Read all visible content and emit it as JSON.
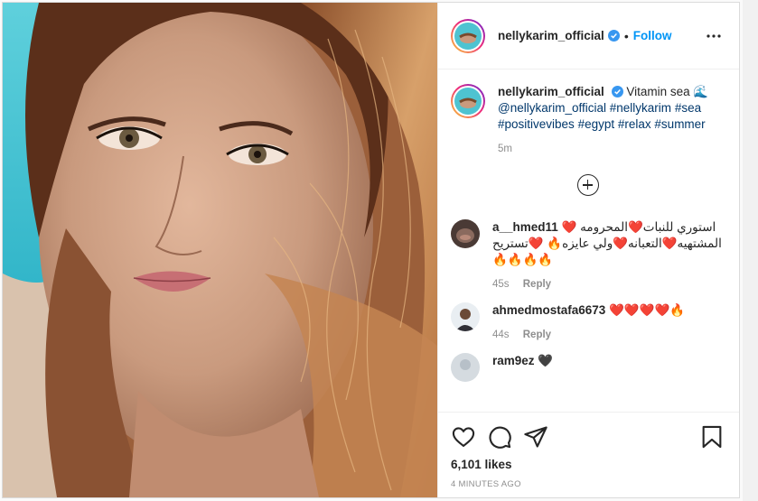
{
  "post": {
    "username": "nellykarim_official",
    "follow_label": "Follow",
    "dot": "•"
  },
  "caption": {
    "username": "nellykarim_official",
    "text": "Vitamin sea 🌊",
    "mention": "@nellykarim_official",
    "hashtags": [
      "#nellykarim",
      "#sea",
      "#positivevibes",
      "#egypt",
      "#relax",
      "#summer"
    ],
    "age": "5m"
  },
  "comments": [
    {
      "username": "a__hmed11",
      "text": "استوري للنبات❤️المحرومه ❤️المشتهيه❤️التعبانه❤️ولي عايزه🔥 ❤️تستريح🔥🔥🔥🔥",
      "age": "45s",
      "reply_label": "Reply"
    },
    {
      "username": "ahmedmostafa6673",
      "text": "❤️❤️❤️❤️🔥",
      "age": "44s",
      "reply_label": "Reply"
    },
    {
      "username": "ram9ez",
      "text": "🖤",
      "age": "",
      "reply_label": ""
    }
  ],
  "likes_text": "6,101 likes",
  "timestamp": "4 MINUTES AGO",
  "icons": [
    "verified-icon",
    "more-icon",
    "load-more-icon",
    "heart-icon",
    "comment-icon",
    "share-icon",
    "bookmark-icon"
  ],
  "colors": {
    "accent": "#0095f6",
    "link": "#00376b",
    "muted": "#8e8e8e"
  }
}
